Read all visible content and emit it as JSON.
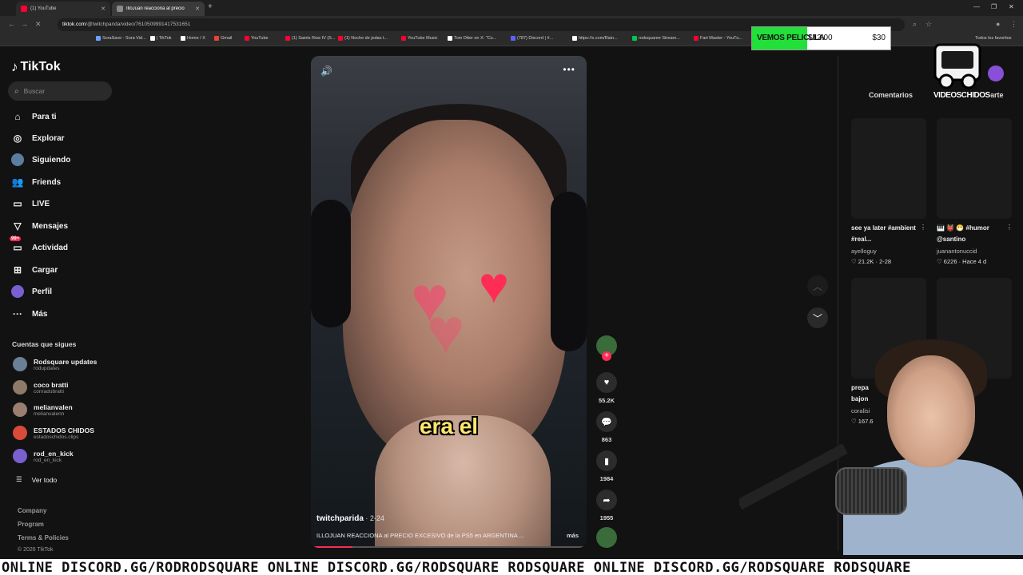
{
  "browser": {
    "tabs": [
      {
        "label": "(1) YouTube",
        "color": "#ff0033"
      },
      {
        "label": "IlloJuan reacciona al precio",
        "color": "#8a8a8a"
      }
    ],
    "url_host": "tiktok.com",
    "url_path": "/@twitchparida/video/7610509991417531651",
    "bookmarks": [
      {
        "label": "SoraSave - Sora Vid...",
        "color": "#6aa2ff"
      },
      {
        "label": "| TikTok",
        "color": "#ffffff"
      },
      {
        "label": "Home / X",
        "color": "#ffffff"
      },
      {
        "label": "Gmail",
        "color": "#ea4335"
      },
      {
        "label": "YouTube",
        "color": "#ff0033"
      },
      {
        "label": "(1) Saints Row IV (S...",
        "color": "#ff0033"
      },
      {
        "label": "(1) Noche de jodas t...",
        "color": "#ff0033"
      },
      {
        "label": "YouTube Music",
        "color": "#ff0033"
      },
      {
        "label": "Tom Dtter on X: \"Co...",
        "color": "#ffffff"
      },
      {
        "label": "(787) Discord | #...",
        "color": "#5865f2"
      },
      {
        "label": "https://x.com/Rain...",
        "color": "#ffffff"
      },
      {
        "label": "rodsquaree Stream...",
        "color": "#00c853"
      },
      {
        "label": "Fart Master - YouTu...",
        "color": "#ff0033"
      }
    ],
    "bookmarks_right": "Todos los favoritos"
  },
  "price_overlay": {
    "label": "VEMOS PELICULA",
    "current": "$12.00",
    "goal": "$30",
    "progress": 0.4
  },
  "sidebar": {
    "logo": "TikTok",
    "search_placeholder": "Buscar",
    "nav": [
      {
        "label": "Para ti",
        "icon": "home-icon",
        "glyph": "⌂"
      },
      {
        "label": "Explorar",
        "icon": "compass-icon",
        "glyph": "◎"
      },
      {
        "label": "Siguiendo",
        "icon": "following-avatar-icon",
        "glyph": "●"
      },
      {
        "label": "Friends",
        "icon": "friends-icon",
        "glyph": "👥"
      },
      {
        "label": "LIVE",
        "icon": "live-icon",
        "glyph": "▭"
      },
      {
        "label": "Mensajes",
        "icon": "messages-icon",
        "glyph": "▽"
      },
      {
        "label": "Actividad",
        "icon": "activity-icon",
        "glyph": "▭",
        "badge": "99+"
      },
      {
        "label": "Cargar",
        "icon": "upload-icon",
        "glyph": "⊞"
      },
      {
        "label": "Perfil",
        "icon": "profile-avatar-icon",
        "glyph": "●"
      },
      {
        "label": "Más",
        "icon": "more-icon",
        "glyph": "···"
      }
    ],
    "following_title": "Cuentas que sigues",
    "following": [
      {
        "name": "Rodsquare updates",
        "handle": "rodupdates",
        "color": "#6b7f96"
      },
      {
        "name": "coco bratti",
        "handle": "conradobratti",
        "color": "#8d7a68"
      },
      {
        "name": "melianvalen",
        "handle": "melianvalenn",
        "color": "#9a7e70"
      },
      {
        "name": "ESTADOS CHIDOS",
        "handle": "estadoschidos.clips",
        "color": "#d84a3a"
      },
      {
        "name": "rod_en_kick",
        "handle": "rod_en_kick",
        "color": "#7a5fd0"
      }
    ],
    "see_all": "Ver todo",
    "footer": [
      "Company",
      "Program",
      "Terms & Policies"
    ],
    "copyright": "© 2026 TikTok"
  },
  "video": {
    "caption_word": "era el",
    "author": "twitchparida",
    "date": "2-24",
    "description": "ILLOJUAN REACCIONA al PRECIO EXCESIVO de la PS5 en ARGENTINA ...",
    "more_label": "más",
    "progress": 0.15
  },
  "actions": {
    "likes": "55.2K",
    "comments": "863",
    "saves": "1984",
    "shares": "1955"
  },
  "right_panel": {
    "tabs": [
      "Comentarios",
      "arte"
    ],
    "items": [
      {
        "title": "see ya later #ambient #real...",
        "user": "ayelloguy",
        "meta": "♡ 21.2K · 2-28"
      },
      {
        "title": "🎹 👹 😷 #humor @santino",
        "user": "juanantonuccid",
        "meta": "♡ 6226 · Hace 4 d"
      },
      {
        "title": "prepa bajon",
        "user": "coralisi",
        "meta": "♡ 167.6"
      }
    ]
  },
  "overlay": {
    "channel_logo_text": "VIDEOSCHIDOS",
    "ticker": "ONLINE DISCORD.GG/RODRODSQUARE ONLINE DISCORD.GG/RODSQUARE RODSQUARE ONLINE DISCORD.GG/RODSQUARE RODSQUARE"
  }
}
